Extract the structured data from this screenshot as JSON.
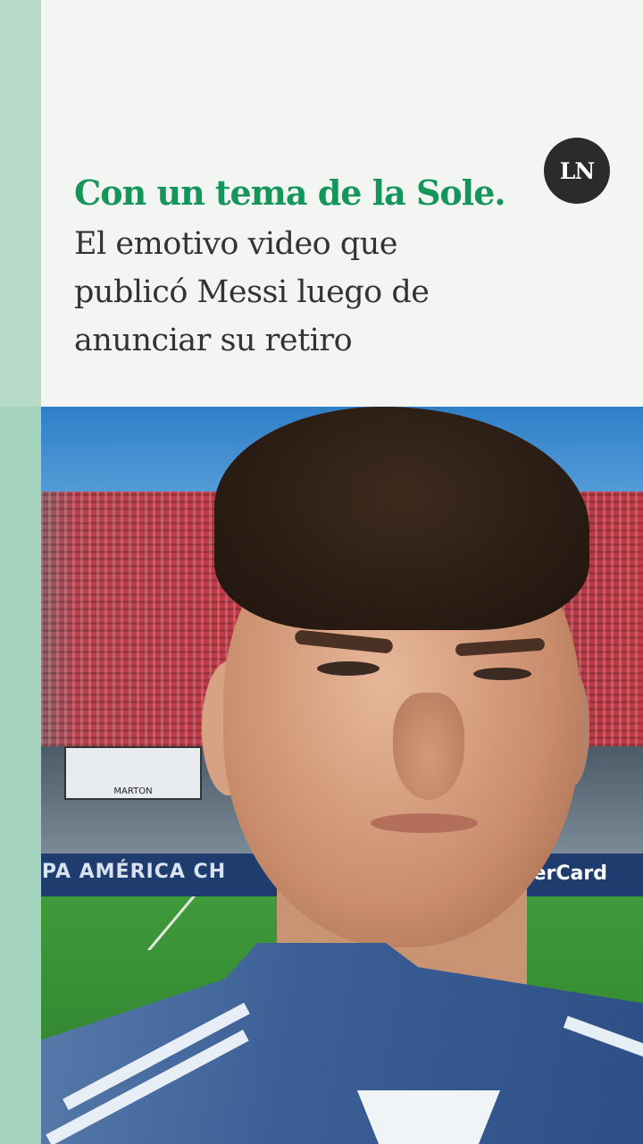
{
  "header": {
    "logo_text": "LN",
    "headline": "Con un tema de la Sole.",
    "subhead_lines": [
      "El emotivo video que",
      "publicó Messi luego de",
      "anunciar su retiro"
    ]
  },
  "photo": {
    "banner_text": "MARTON",
    "ad_left": "COPA AMÉRICA CH",
    "ad_right": "erCard"
  },
  "colors": {
    "headline": "#16955a",
    "accent_bar": "#b7dbc9",
    "background": "#f3f5f2"
  }
}
